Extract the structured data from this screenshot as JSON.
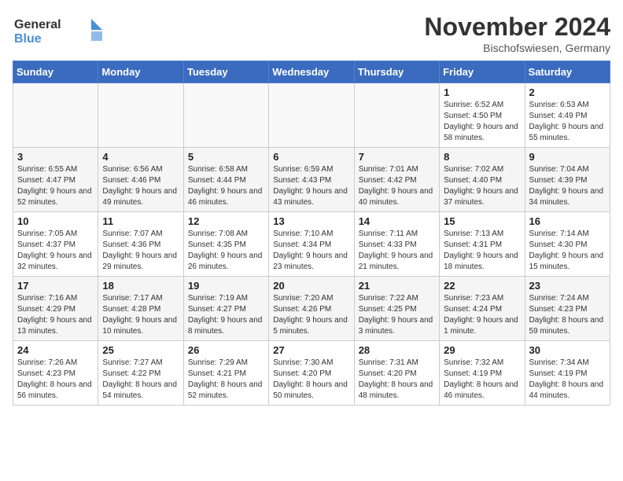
{
  "logo": {
    "line1": "General",
    "line2": "Blue"
  },
  "title": "November 2024",
  "location": "Bischofswiesen, Germany",
  "headers": [
    "Sunday",
    "Monday",
    "Tuesday",
    "Wednesday",
    "Thursday",
    "Friday",
    "Saturday"
  ],
  "weeks": [
    [
      {
        "day": "",
        "info": ""
      },
      {
        "day": "",
        "info": ""
      },
      {
        "day": "",
        "info": ""
      },
      {
        "day": "",
        "info": ""
      },
      {
        "day": "",
        "info": ""
      },
      {
        "day": "1",
        "info": "Sunrise: 6:52 AM\nSunset: 4:50 PM\nDaylight: 9 hours and 58 minutes."
      },
      {
        "day": "2",
        "info": "Sunrise: 6:53 AM\nSunset: 4:49 PM\nDaylight: 9 hours and 55 minutes."
      }
    ],
    [
      {
        "day": "3",
        "info": "Sunrise: 6:55 AM\nSunset: 4:47 PM\nDaylight: 9 hours and 52 minutes."
      },
      {
        "day": "4",
        "info": "Sunrise: 6:56 AM\nSunset: 4:46 PM\nDaylight: 9 hours and 49 minutes."
      },
      {
        "day": "5",
        "info": "Sunrise: 6:58 AM\nSunset: 4:44 PM\nDaylight: 9 hours and 46 minutes."
      },
      {
        "day": "6",
        "info": "Sunrise: 6:59 AM\nSunset: 4:43 PM\nDaylight: 9 hours and 43 minutes."
      },
      {
        "day": "7",
        "info": "Sunrise: 7:01 AM\nSunset: 4:42 PM\nDaylight: 9 hours and 40 minutes."
      },
      {
        "day": "8",
        "info": "Sunrise: 7:02 AM\nSunset: 4:40 PM\nDaylight: 9 hours and 37 minutes."
      },
      {
        "day": "9",
        "info": "Sunrise: 7:04 AM\nSunset: 4:39 PM\nDaylight: 9 hours and 34 minutes."
      }
    ],
    [
      {
        "day": "10",
        "info": "Sunrise: 7:05 AM\nSunset: 4:37 PM\nDaylight: 9 hours and 32 minutes."
      },
      {
        "day": "11",
        "info": "Sunrise: 7:07 AM\nSunset: 4:36 PM\nDaylight: 9 hours and 29 minutes."
      },
      {
        "day": "12",
        "info": "Sunrise: 7:08 AM\nSunset: 4:35 PM\nDaylight: 9 hours and 26 minutes."
      },
      {
        "day": "13",
        "info": "Sunrise: 7:10 AM\nSunset: 4:34 PM\nDaylight: 9 hours and 23 minutes."
      },
      {
        "day": "14",
        "info": "Sunrise: 7:11 AM\nSunset: 4:33 PM\nDaylight: 9 hours and 21 minutes."
      },
      {
        "day": "15",
        "info": "Sunrise: 7:13 AM\nSunset: 4:31 PM\nDaylight: 9 hours and 18 minutes."
      },
      {
        "day": "16",
        "info": "Sunrise: 7:14 AM\nSunset: 4:30 PM\nDaylight: 9 hours and 15 minutes."
      }
    ],
    [
      {
        "day": "17",
        "info": "Sunrise: 7:16 AM\nSunset: 4:29 PM\nDaylight: 9 hours and 13 minutes."
      },
      {
        "day": "18",
        "info": "Sunrise: 7:17 AM\nSunset: 4:28 PM\nDaylight: 9 hours and 10 minutes."
      },
      {
        "day": "19",
        "info": "Sunrise: 7:19 AM\nSunset: 4:27 PM\nDaylight: 9 hours and 8 minutes."
      },
      {
        "day": "20",
        "info": "Sunrise: 7:20 AM\nSunset: 4:26 PM\nDaylight: 9 hours and 5 minutes."
      },
      {
        "day": "21",
        "info": "Sunrise: 7:22 AM\nSunset: 4:25 PM\nDaylight: 9 hours and 3 minutes."
      },
      {
        "day": "22",
        "info": "Sunrise: 7:23 AM\nSunset: 4:24 PM\nDaylight: 9 hours and 1 minute."
      },
      {
        "day": "23",
        "info": "Sunrise: 7:24 AM\nSunset: 4:23 PM\nDaylight: 8 hours and 59 minutes."
      }
    ],
    [
      {
        "day": "24",
        "info": "Sunrise: 7:26 AM\nSunset: 4:23 PM\nDaylight: 8 hours and 56 minutes."
      },
      {
        "day": "25",
        "info": "Sunrise: 7:27 AM\nSunset: 4:22 PM\nDaylight: 8 hours and 54 minutes."
      },
      {
        "day": "26",
        "info": "Sunrise: 7:29 AM\nSunset: 4:21 PM\nDaylight: 8 hours and 52 minutes."
      },
      {
        "day": "27",
        "info": "Sunrise: 7:30 AM\nSunset: 4:20 PM\nDaylight: 8 hours and 50 minutes."
      },
      {
        "day": "28",
        "info": "Sunrise: 7:31 AM\nSunset: 4:20 PM\nDaylight: 8 hours and 48 minutes."
      },
      {
        "day": "29",
        "info": "Sunrise: 7:32 AM\nSunset: 4:19 PM\nDaylight: 8 hours and 46 minutes."
      },
      {
        "day": "30",
        "info": "Sunrise: 7:34 AM\nSunset: 4:19 PM\nDaylight: 8 hours and 44 minutes."
      }
    ]
  ]
}
